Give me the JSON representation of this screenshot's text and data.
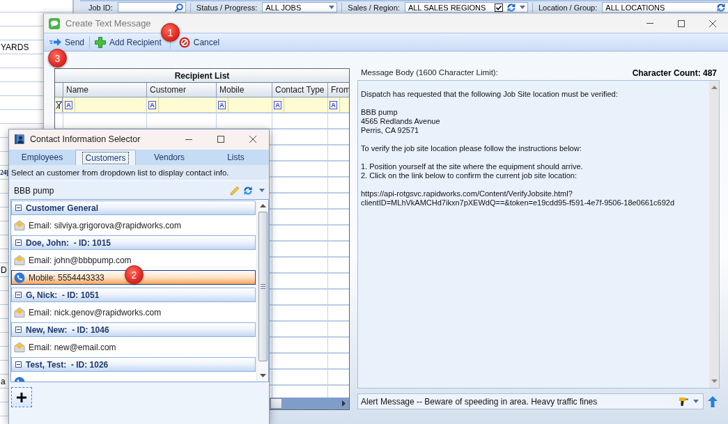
{
  "background": {
    "filters": [
      {
        "kind": "search",
        "label": "Job ID:"
      },
      {
        "kind": "dropdown",
        "label": "Status / Progress:",
        "value": "ALL JOBS"
      },
      {
        "kind": "dropdown_check",
        "label": "Sales / Region:",
        "value": "ALL SALES REGIONS",
        "checked": true
      },
      {
        "kind": "dropdown_refresh",
        "label": "Location / Group:",
        "value": "ALL LOCATIONS"
      }
    ],
    "rows": [
      {},
      {},
      {
        "cell": "YARDS",
        "bold": false
      },
      {},
      {},
      {},
      {},
      {},
      {},
      {},
      {},
      {
        "cell": "24]",
        "bold": true
      },
      {},
      {},
      {},
      {},
      {},
      {},
      {
        "cell": "D",
        "bold": false
      },
      {},
      {},
      {},
      {},
      {},
      {},
      {},
      {
        "cell": "a",
        "bold": false
      },
      {},
      {},
      {}
    ]
  },
  "compose_window": {
    "title": "Create Text Message",
    "toolbar": [
      {
        "kind": "send",
        "label": "Send"
      },
      {
        "kind": "add",
        "label": "Add Recipient"
      },
      {
        "kind": "cancel",
        "label": "Cancel"
      }
    ],
    "recipient_list": {
      "title": "Recipient List",
      "columns": [
        {
          "label": "Name",
          "filter_operator": "A"
        },
        {
          "label": "Customer",
          "filter_operator": "A"
        },
        {
          "label": "Mobile",
          "filter_operator": "A"
        },
        {
          "label": "Contact Type",
          "filter_operator": "A"
        },
        {
          "label": "From",
          "filter_operator": "A"
        }
      ]
    },
    "message": {
      "label": "Message Body (1600 Character Limit):",
      "character_count": "Character Count: 487",
      "body": "Dispatch has requested that the following Job Site location must be verified:\n\nBBB pump\n4565 Redlands Avenue\nPerris, CA 92571\n\nTo verify the job site location please follow the instructions below:\n\n1. Position yourself at the site where the equipment should arrive.\n2. Click on the link below to confirm the current job site location:\n\nhttps://api-rotgsvc.rapidworks.com/Content/VerifyJobsite.html?\nclientID=MLhVkAMCHd7ikxn7pXEWdQ==&token=e19cdd95-f591-4e7f-9506-18e0661c692d"
    },
    "alert": {
      "value": "Alert Message -- Beware of speeding in area. Heavy traffic fines"
    }
  },
  "contact_selector": {
    "title": "Contact Information Selector",
    "tabs": [
      {
        "label": "Employees",
        "selected": false
      },
      {
        "label": "Customers",
        "selected": true
      },
      {
        "label": "Vendors",
        "selected": false
      },
      {
        "label": "Lists",
        "selected": false
      }
    ],
    "hint": "Select an customer from dropdown list to display contact info.",
    "customer": "BBB pump",
    "groups": [
      {
        "title": "Customer General",
        "expanded": true,
        "items": [
          {
            "kind": "email",
            "text": "Email: silviya.grigorova@rapidworks.com",
            "selected": false
          }
        ]
      },
      {
        "title": "Doe, John:  - ID: 1015",
        "expanded": true,
        "items": [
          {
            "kind": "email",
            "text": "Email: john@bbbpump.com",
            "selected": false
          },
          {
            "kind": "mobile",
            "text": "Mobile: 5554443333",
            "selected": true
          }
        ]
      },
      {
        "title": "G, Nick:  - ID: 1051",
        "expanded": true,
        "items": [
          {
            "kind": "email",
            "text": "Email: nick.genov@rapidworks.com",
            "selected": false
          }
        ]
      },
      {
        "title": "New, New:  - ID: 1046",
        "expanded": true,
        "items": [
          {
            "kind": "email",
            "text": "Email: new@email.com",
            "selected": false
          }
        ]
      },
      {
        "title": "Test, Test:  - ID: 1026",
        "expanded": true,
        "items": [
          {
            "kind": "mobile",
            "selected": false
          }
        ]
      }
    ]
  },
  "callouts": [
    {
      "label": "1"
    },
    {
      "label": "2"
    },
    {
      "label": "3"
    }
  ]
}
